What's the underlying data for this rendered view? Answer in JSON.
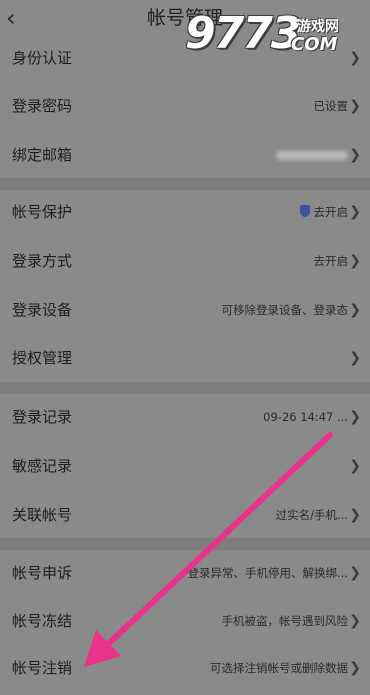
{
  "header": {
    "back_icon": "chevron-left-icon",
    "title": "帐号管理"
  },
  "watermark": {
    "number": "9773",
    "top_text": "游戏网",
    "bottom_text": "COM"
  },
  "rows": [
    {
      "label": "身份认证",
      "value": "",
      "group": 1
    },
    {
      "label": "登录密码",
      "value": "已设置",
      "group": 1
    },
    {
      "label": "绑定邮箱",
      "value": "",
      "group": 1
    },
    {
      "label": "帐号保护",
      "value": "去开启",
      "group": 2
    },
    {
      "label": "登录方式",
      "value": "去开启",
      "group": 2
    },
    {
      "label": "登录设备",
      "value": "可移除登录设备、登录态",
      "group": 2
    },
    {
      "label": "授权管理",
      "value": "",
      "group": 2
    },
    {
      "label": "登录记录",
      "value": "09-26 14:47 ...",
      "group": 3
    },
    {
      "label": "敏感记录",
      "value": "",
      "group": 3
    },
    {
      "label": "关联帐号",
      "value": "过实名/手机...",
      "group": 3
    },
    {
      "label": "帐号申诉",
      "value": "登录异常、手机停用、解换绑...",
      "group": 4
    },
    {
      "label": "帐号冻结",
      "value": "手机被盗，帐号遇到风险",
      "group": 4
    },
    {
      "label": "帐号注销",
      "value": "可选择注销帐号或删除数据",
      "group": 4
    }
  ],
  "colors": {
    "overlay_bg": "#8a8a8a",
    "arrow": "#e8338a",
    "shield": "#3a55a8"
  }
}
